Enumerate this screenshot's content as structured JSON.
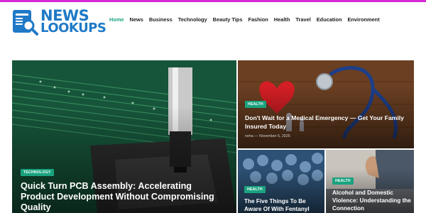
{
  "brand": {
    "line1": "NEWS",
    "line2": "LOOKUPS",
    "color": "#1f79c7"
  },
  "nav": {
    "items": [
      {
        "label": "Home",
        "active": true
      },
      {
        "label": "News"
      },
      {
        "label": "Business"
      },
      {
        "label": "Technology"
      },
      {
        "label": "Beauty Tips"
      },
      {
        "label": "Fashion"
      },
      {
        "label": "Health"
      },
      {
        "label": "Travel"
      },
      {
        "label": "Education"
      },
      {
        "label": "Environment"
      }
    ]
  },
  "colors": {
    "accent": "#1aa27f",
    "top_strip": "#d62ad6"
  },
  "posts": {
    "main": {
      "category": "TECHNOLOGY",
      "title": "Quick Turn PCB Assembly: Accelerating Product Development Without Compromising Quality"
    },
    "top": {
      "category": "HEALTH",
      "title": "Don't Wait for a Medical Emergency — Get Your Family Insured Today",
      "author": "neha",
      "date": "November 6, 2025"
    },
    "bottom_left": {
      "category": "HEALTH",
      "title": "The Five Things To Be Aware Of With Fentanyl"
    },
    "bottom_right": {
      "category": "HEALTH",
      "title": "Alcohol and Domestic Violence: Understanding the Connection"
    }
  }
}
